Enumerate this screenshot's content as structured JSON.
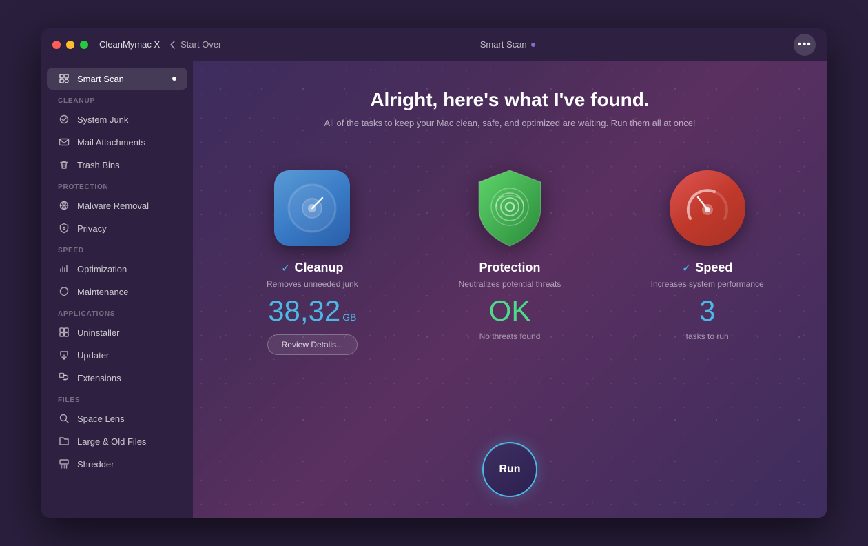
{
  "window": {
    "title": "CleanMymac X"
  },
  "titlebar": {
    "app_name": "CleanMymac X",
    "nav_label": "Start Over",
    "scan_label": "Smart Scan",
    "more_label": "•••"
  },
  "sidebar": {
    "active_item": "smart-scan",
    "sections": [
      {
        "id": "top",
        "label": "",
        "items": [
          {
            "id": "smart-scan",
            "label": "Smart Scan",
            "icon": "scan",
            "active": true
          }
        ]
      },
      {
        "id": "cleanup",
        "label": "Cleanup",
        "items": [
          {
            "id": "system-junk",
            "label": "System Junk",
            "icon": "junk"
          },
          {
            "id": "mail-attachments",
            "label": "Mail Attachments",
            "icon": "mail"
          },
          {
            "id": "trash-bins",
            "label": "Trash Bins",
            "icon": "trash"
          }
        ]
      },
      {
        "id": "protection",
        "label": "Protection",
        "items": [
          {
            "id": "malware-removal",
            "label": "Malware Removal",
            "icon": "malware"
          },
          {
            "id": "privacy",
            "label": "Privacy",
            "icon": "privacy"
          }
        ]
      },
      {
        "id": "speed",
        "label": "Speed",
        "items": [
          {
            "id": "optimization",
            "label": "Optimization",
            "icon": "optimization"
          },
          {
            "id": "maintenance",
            "label": "Maintenance",
            "icon": "maintenance"
          }
        ]
      },
      {
        "id": "applications",
        "label": "Applications",
        "items": [
          {
            "id": "uninstaller",
            "label": "Uninstaller",
            "icon": "uninstaller"
          },
          {
            "id": "updater",
            "label": "Updater",
            "icon": "updater"
          },
          {
            "id": "extensions",
            "label": "Extensions",
            "icon": "extensions"
          }
        ]
      },
      {
        "id": "files",
        "label": "Files",
        "items": [
          {
            "id": "space-lens",
            "label": "Space Lens",
            "icon": "space-lens"
          },
          {
            "id": "large-old-files",
            "label": "Large & Old Files",
            "icon": "files"
          },
          {
            "id": "shredder",
            "label": "Shredder",
            "icon": "shredder"
          }
        ]
      }
    ]
  },
  "content": {
    "title": "Alright, here's what I've found.",
    "subtitle": "All of the tasks to keep your Mac clean, safe, and optimized are waiting. Run them all at once!",
    "cards": [
      {
        "id": "cleanup",
        "title": "Cleanup",
        "desc": "Removes unneeded junk",
        "value": "38,32",
        "unit": "GB",
        "sub": "",
        "has_check": true,
        "has_review": true,
        "review_label": "Review Details..."
      },
      {
        "id": "protection",
        "title": "Protection",
        "desc": "Neutralizes potential threats",
        "value": "OK",
        "unit": "",
        "sub": "No threats found",
        "has_check": false,
        "has_review": false
      },
      {
        "id": "speed",
        "title": "Speed",
        "desc": "Increases system performance",
        "value": "3",
        "unit": "",
        "sub": "tasks to run",
        "has_check": true,
        "has_review": false
      }
    ],
    "run_button_label": "Run"
  }
}
